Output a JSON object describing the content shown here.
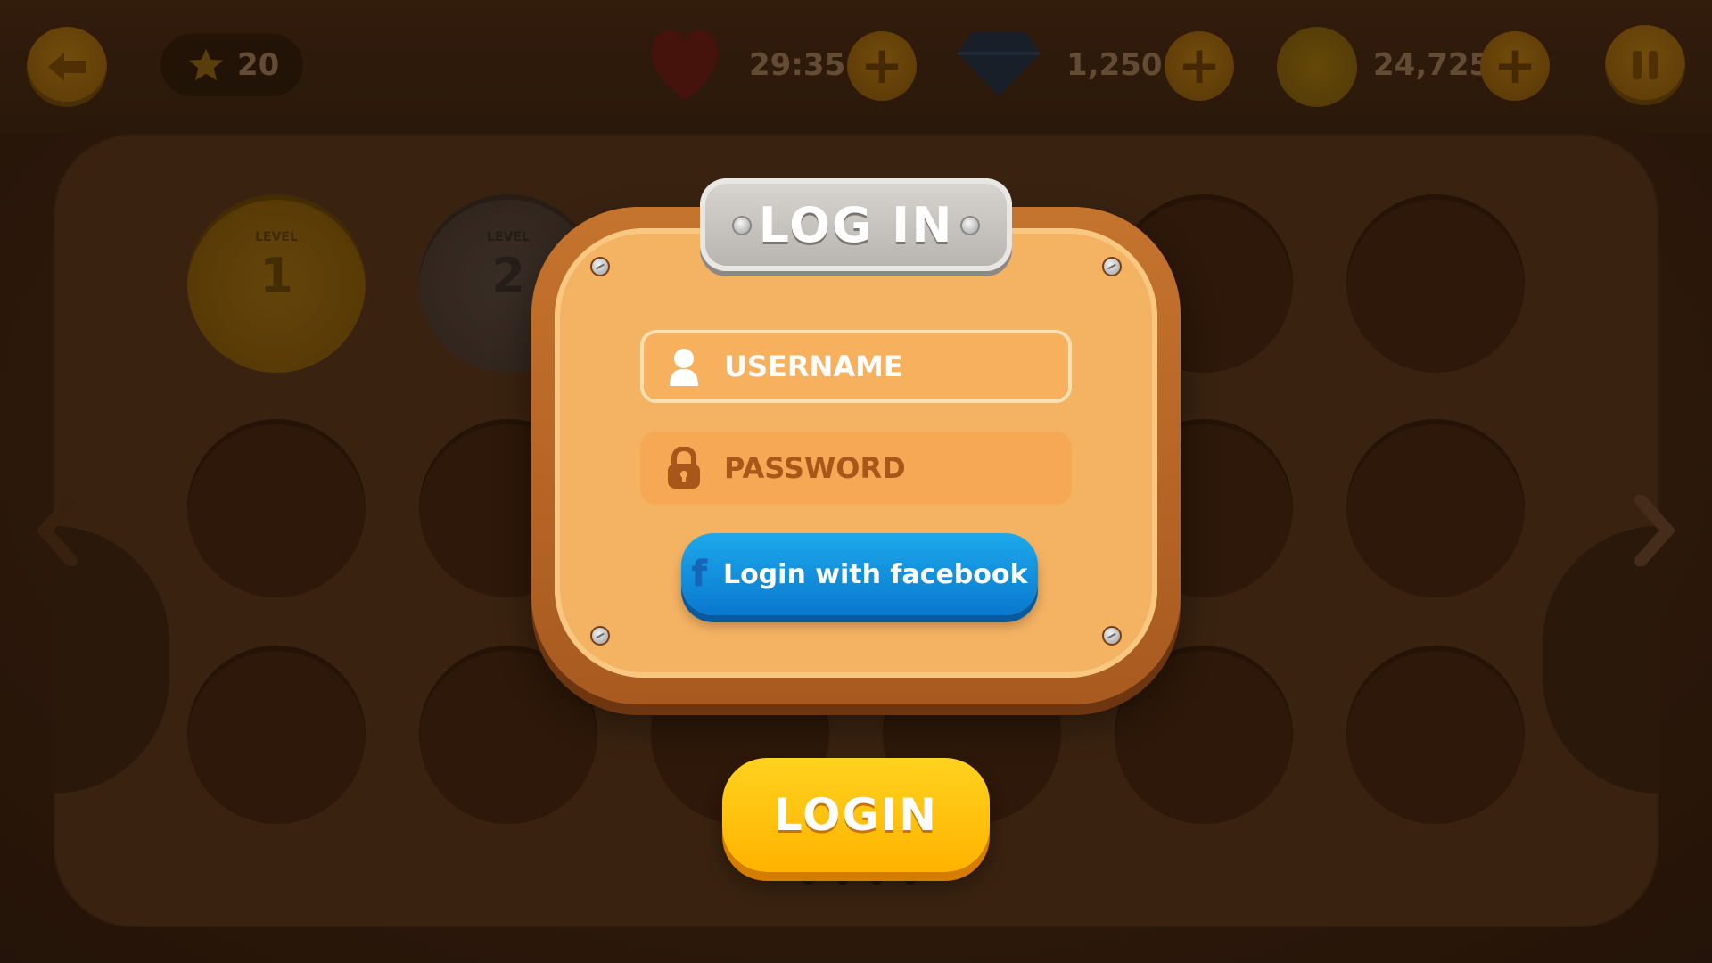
{
  "topbar": {
    "stars": "20",
    "lives_timer": "29:35",
    "gems": "1,250",
    "coins": "24,725"
  },
  "levels": [
    {
      "label": "LEVEL",
      "number": "1"
    },
    {
      "label": "LEVEL",
      "number": "2"
    }
  ],
  "dialog": {
    "title": "LOG IN",
    "username_placeholder": "USERNAME",
    "password_placeholder": "PASSWORD",
    "facebook_icon": "f",
    "facebook_label": "Login with facebook"
  },
  "login_button": "LOGIN",
  "colors": {
    "panel": "#f4b263",
    "frame": "#b8642a",
    "facebook_blue": "#0a78cf",
    "login_yellow": "#ffc20e"
  },
  "icons": [
    "back-arrow-icon",
    "star-icon",
    "heart-icon",
    "gem-icon",
    "coin-icon",
    "plus-icon",
    "pause-icon",
    "user-icon",
    "lock-icon",
    "facebook-icon",
    "next-arrow-icon"
  ]
}
